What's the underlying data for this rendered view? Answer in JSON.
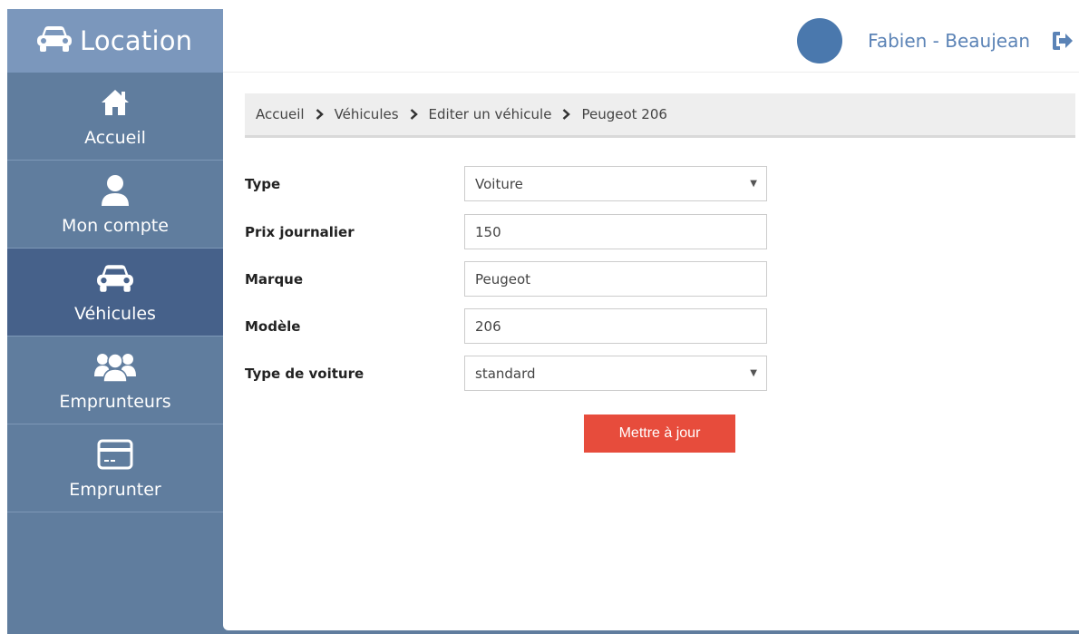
{
  "brand": {
    "title": "Location",
    "icon": "car-icon"
  },
  "sidebar": {
    "items": [
      {
        "label": "Accueil",
        "icon": "home-icon",
        "active": false
      },
      {
        "label": "Mon compte",
        "icon": "user-icon",
        "active": false
      },
      {
        "label": "Véhicules",
        "icon": "car-icon",
        "active": true
      },
      {
        "label": "Emprunteurs",
        "icon": "users-icon",
        "active": false
      },
      {
        "label": "Emprunter",
        "icon": "credit-card-icon",
        "active": false
      }
    ]
  },
  "header": {
    "username": "Fabien - Beaujean",
    "avatar_color": "#4a78ad",
    "logout_icon": "sign-out-icon"
  },
  "breadcrumb": [
    "Accueil",
    "Véhicules",
    "Editer un véhicule",
    "Peugeot 206"
  ],
  "form": {
    "type": {
      "label": "Type",
      "value": "Voiture"
    },
    "price": {
      "label": "Prix journalier",
      "value": "150"
    },
    "brand": {
      "label": "Marque",
      "value": "Peugeot"
    },
    "model": {
      "label": "Modèle",
      "value": "206"
    },
    "car_type": {
      "label": "Type de voiture",
      "value": "standard"
    },
    "submit_label": "Mettre à jour"
  },
  "colors": {
    "sidebar": "#607d9e",
    "sidebar_header": "#7b97bc",
    "sidebar_active": "#46618a",
    "accent": "#5b83b6",
    "button": "#e74c3c"
  }
}
